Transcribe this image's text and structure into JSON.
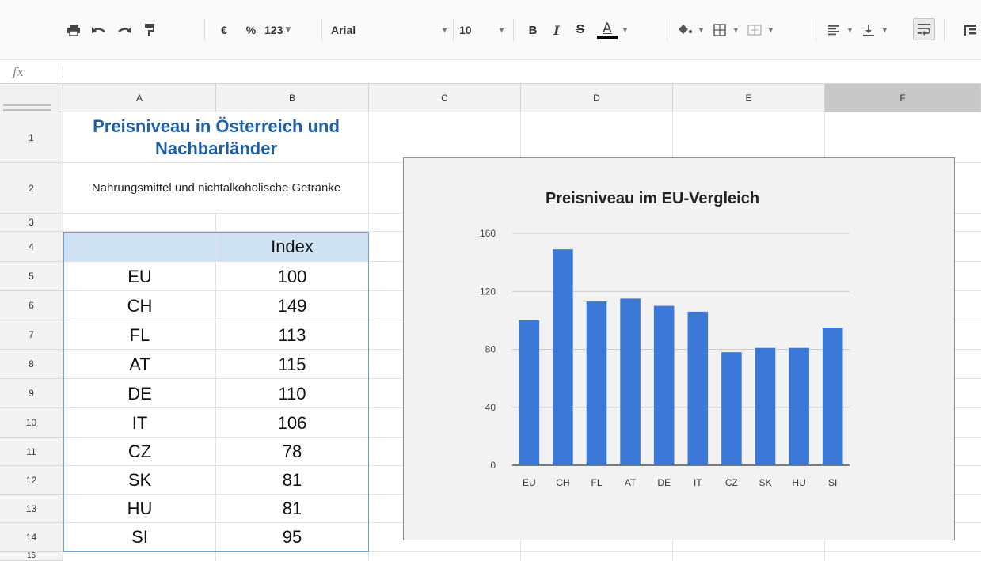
{
  "toolbar": {
    "buttons": [
      {
        "name": "print-button",
        "icon": "print-icon"
      },
      {
        "name": "undo-button",
        "icon": "undo-icon"
      },
      {
        "name": "redo-button",
        "icon": "redo-icon"
      },
      {
        "name": "paint-format-button",
        "icon": "paint-format-icon"
      }
    ],
    "currency_label": "€",
    "percent_label": "%",
    "number_format_label": "123",
    "font_family": "Arial",
    "font_size": "10",
    "bold_label": "B",
    "italic_label": "I",
    "strikethrough_label": "S",
    "text_color_label": "A"
  },
  "formula_bar": {
    "fx_label": "fx",
    "value": ""
  },
  "columns": [
    "A",
    "B",
    "C",
    "D",
    "E",
    "F"
  ],
  "active_column": "F",
  "rows": [
    "1",
    "2",
    "3",
    "4",
    "5",
    "6",
    "7",
    "8",
    "9",
    "10",
    "11",
    "12",
    "13",
    "14",
    "15"
  ],
  "sheet": {
    "title": "Preisniveau in Österreich und Nachbarländer",
    "subtitle": "Nahrungsmittel und nichtalkoholische Getränke",
    "table_header": {
      "country": "",
      "index": "Index"
    },
    "table_rows": [
      {
        "country": "EU",
        "index": "100"
      },
      {
        "country": "CH",
        "index": "149"
      },
      {
        "country": "FL",
        "index": "113"
      },
      {
        "country": "AT",
        "index": "115"
      },
      {
        "country": "DE",
        "index": "110"
      },
      {
        "country": "IT",
        "index": "106"
      },
      {
        "country": "CZ",
        "index": "78"
      },
      {
        "country": "SK",
        "index": "81"
      },
      {
        "country": "HU",
        "index": "81"
      },
      {
        "country": "SI",
        "index": "95"
      }
    ]
  },
  "chart_data": {
    "type": "bar",
    "title": "Preisniveau im EU-Vergleich",
    "categories": [
      "EU",
      "CH",
      "FL",
      "AT",
      "DE",
      "IT",
      "CZ",
      "SK",
      "HU",
      "SI"
    ],
    "values": [
      100,
      149,
      113,
      115,
      110,
      106,
      78,
      81,
      81,
      95
    ],
    "yticks": [
      0,
      40,
      80,
      120,
      160
    ],
    "ylim": [
      0,
      160
    ],
    "xlabel": "",
    "ylabel": "",
    "grid": true,
    "legend": "none",
    "bar_color": "#3c78d8"
  },
  "colors": {
    "title_blue": "#1f5fa6",
    "header_fill": "#cfe2f3",
    "table_border": "#6f9fd8",
    "bar": "#3c78d8"
  }
}
